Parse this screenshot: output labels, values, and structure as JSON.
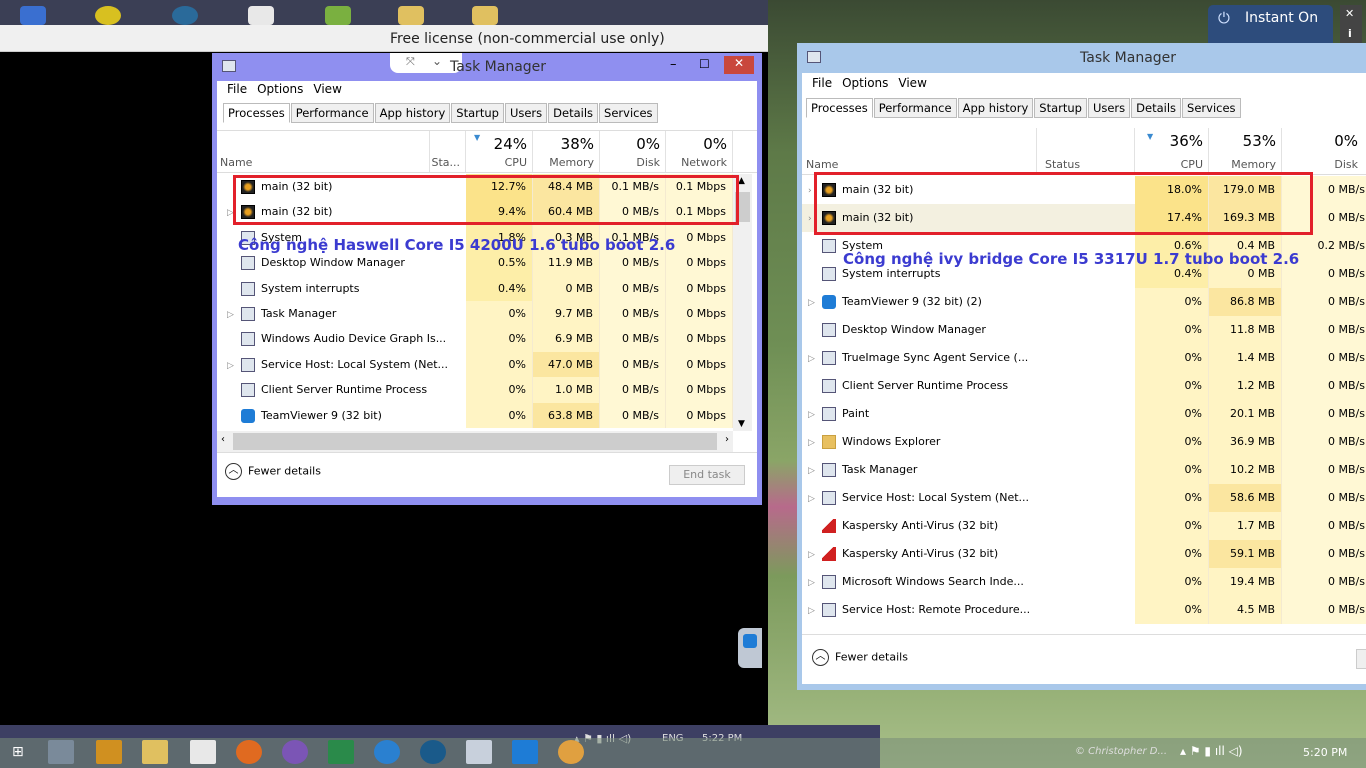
{
  "remote_bar": {
    "license": "Free license (non-commercial use only)"
  },
  "instant_on": {
    "label": "Instant On",
    "close": "✕",
    "info": "i"
  },
  "left_tm": {
    "title": "Task Manager",
    "menu": [
      "File",
      "Options",
      "View"
    ],
    "tabs": [
      "Processes",
      "Performance",
      "App history",
      "Startup",
      "Users",
      "Details",
      "Services"
    ],
    "columns": {
      "name": "Name",
      "status": "Sta...",
      "cpu_pct": "24%",
      "cpu": "CPU",
      "mem_pct": "38%",
      "mem": "Memory",
      "disk_pct": "0%",
      "disk": "Disk",
      "net_pct": "0%",
      "net": "Network"
    },
    "rows": [
      {
        "icon": "main",
        "exp": "",
        "name": "main (32 bit)",
        "cpu": "12.7%",
        "mem": "48.4 MB",
        "disk": "0.1 MB/s",
        "net": "0.1 Mbps"
      },
      {
        "icon": "main",
        "exp": "▷",
        "name": "main (32 bit)",
        "cpu": "9.4%",
        "mem": "60.4 MB",
        "disk": "0 MB/s",
        "net": "0.1 Mbps"
      },
      {
        "icon": "sys",
        "exp": "",
        "name": "System",
        "cpu": "1.8%",
        "mem": "0.3 MB",
        "disk": "0.1 MB/s",
        "net": "0 Mbps"
      },
      {
        "icon": "sys",
        "exp": "",
        "name": "Desktop Window Manager",
        "cpu": "0.5%",
        "mem": "11.9 MB",
        "disk": "0 MB/s",
        "net": "0 Mbps"
      },
      {
        "icon": "sys",
        "exp": "",
        "name": "System interrupts",
        "cpu": "0.4%",
        "mem": "0 MB",
        "disk": "0 MB/s",
        "net": "0 Mbps"
      },
      {
        "icon": "sys",
        "exp": "▷",
        "name": "Task Manager",
        "cpu": "0%",
        "mem": "9.7 MB",
        "disk": "0 MB/s",
        "net": "0 Mbps"
      },
      {
        "icon": "sys",
        "exp": "",
        "name": "Windows Audio Device Graph Is...",
        "cpu": "0%",
        "mem": "6.9 MB",
        "disk": "0 MB/s",
        "net": "0 Mbps"
      },
      {
        "icon": "sys",
        "exp": "▷",
        "name": "Service Host: Local System (Net...",
        "cpu": "0%",
        "mem": "47.0 MB",
        "disk": "0 MB/s",
        "net": "0 Mbps"
      },
      {
        "icon": "sys",
        "exp": "",
        "name": "Client Server Runtime Process",
        "cpu": "0%",
        "mem": "1.0 MB",
        "disk": "0 MB/s",
        "net": "0 Mbps"
      },
      {
        "icon": "tv",
        "exp": "",
        "name": "TeamViewer 9 (32 bit)",
        "cpu": "0%",
        "mem": "63.8 MB",
        "disk": "0 MB/s",
        "net": "0 Mbps"
      }
    ],
    "fewer_details": "Fewer details",
    "end_task": "End task",
    "annotation": "Công nghệ Haswell Core I5 4200U 1.6 tubo boot 2.6"
  },
  "right_tm": {
    "title": "Task Manager",
    "menu": [
      "File",
      "Options",
      "View"
    ],
    "tabs": [
      "Processes",
      "Performance",
      "App history",
      "Startup",
      "Users",
      "Details",
      "Services"
    ],
    "columns": {
      "name": "Name",
      "status": "Status",
      "cpu_pct": "36%",
      "cpu": "CPU",
      "mem_pct": "53%",
      "mem": "Memory",
      "disk_pct": "0%",
      "disk": "Disk"
    },
    "rows": [
      {
        "icon": "main",
        "exp": "›",
        "name": "main (32 bit)",
        "cpu": "18.0%",
        "mem": "179.0 MB",
        "disk": "0 MB/s"
      },
      {
        "icon": "main",
        "exp": "›",
        "name": "main (32 bit)",
        "cpu": "17.4%",
        "mem": "169.3 MB",
        "disk": "0 MB/s"
      },
      {
        "icon": "sys",
        "exp": "",
        "name": "System",
        "cpu": "0.6%",
        "mem": "0.4 MB",
        "disk": "0.2 MB/s"
      },
      {
        "icon": "sys",
        "exp": "",
        "name": "System interrupts",
        "cpu": "0.4%",
        "mem": "0 MB",
        "disk": "0 MB/s"
      },
      {
        "icon": "tv",
        "exp": "▷",
        "name": "TeamViewer 9 (32 bit) (2)",
        "cpu": "0%",
        "mem": "86.8 MB",
        "disk": "0 MB/s"
      },
      {
        "icon": "sys",
        "exp": "",
        "name": "Desktop Window Manager",
        "cpu": "0%",
        "mem": "11.8 MB",
        "disk": "0 MB/s"
      },
      {
        "icon": "sys",
        "exp": "▷",
        "name": "TrueImage Sync Agent Service (...",
        "cpu": "0%",
        "mem": "1.4 MB",
        "disk": "0 MB/s"
      },
      {
        "icon": "sys",
        "exp": "",
        "name": "Client Server Runtime Process",
        "cpu": "0%",
        "mem": "1.2 MB",
        "disk": "0 MB/s"
      },
      {
        "icon": "sys",
        "exp": "▷",
        "name": "Paint",
        "cpu": "0%",
        "mem": "20.1 MB",
        "disk": "0 MB/s"
      },
      {
        "icon": "fold",
        "exp": "▷",
        "name": "Windows Explorer",
        "cpu": "0%",
        "mem": "36.9 MB",
        "disk": "0 MB/s"
      },
      {
        "icon": "sys",
        "exp": "▷",
        "name": "Task Manager",
        "cpu": "0%",
        "mem": "10.2 MB",
        "disk": "0 MB/s"
      },
      {
        "icon": "sys",
        "exp": "▷",
        "name": "Service Host: Local System (Net...",
        "cpu": "0%",
        "mem": "58.6 MB",
        "disk": "0 MB/s"
      },
      {
        "icon": "kas",
        "exp": "",
        "name": "Kaspersky Anti-Virus (32 bit)",
        "cpu": "0%",
        "mem": "1.7 MB",
        "disk": "0 MB/s"
      },
      {
        "icon": "kas",
        "exp": "▷",
        "name": "Kaspersky Anti-Virus (32 bit)",
        "cpu": "0%",
        "mem": "59.1 MB",
        "disk": "0 MB/s"
      },
      {
        "icon": "sys",
        "exp": "▷",
        "name": "Microsoft Windows Search Inde...",
        "cpu": "0%",
        "mem": "19.4 MB",
        "disk": "0 MB/s"
      },
      {
        "icon": "sys",
        "exp": "▷",
        "name": "Service Host: Remote Procedure...",
        "cpu": "0%",
        "mem": "4.5 MB",
        "disk": "0 MB/s"
      }
    ],
    "fewer_details": "Fewer details",
    "annotation": "Công nghệ  ivy bridge Core I5 3317U 1.7 tubo boot 2.6"
  },
  "left_taskbar": {
    "lang": "ENG",
    "time": "5:22 PM"
  },
  "right_taskbar": {
    "time": "5:20 PM",
    "watermark": "© Christopher D..."
  }
}
